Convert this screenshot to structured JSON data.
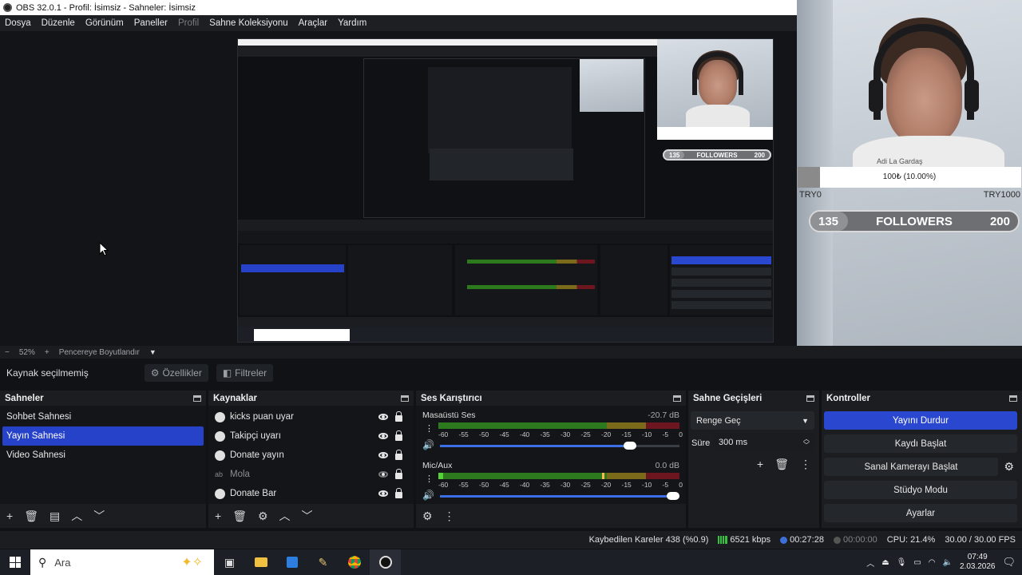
{
  "window": {
    "title": "OBS 32.0.1 - Profil: İsimsiz - Sahneler: İsimsiz"
  },
  "menu": [
    "Dosya",
    "Düzenle",
    "Görünüm",
    "Paneller",
    "Profil",
    "Sahne Koleksiyonu",
    "Araçlar",
    "Yardım"
  ],
  "overlay": {
    "donation_name": "Adi La Gardaş",
    "donation_amount": "100₺ (10.00%)",
    "goal_left": "TRY0",
    "goal_right": "TRY1000",
    "goal_progress": 0.1,
    "followers_current": "135",
    "followers_label": "FOLLOWERS",
    "followers_goal": "200",
    "followers_progress": 0.18
  },
  "preview_toolbar": {
    "zoom": "52%",
    "resize_label": "Pencereye Boyutlandır"
  },
  "source_toolbar": {
    "status": "Kaynak seçilmemiş",
    "properties": "Özellikler",
    "filters": "Filtreler"
  },
  "scenes": {
    "title": "Sahneler",
    "items": [
      "Sohbet Sahnesi",
      "Yayın Sahnesi",
      "Video Sahnesi"
    ],
    "selected_index": 1
  },
  "sources": {
    "title": "Kaynaklar",
    "items": [
      {
        "name": "kicks puan uyar",
        "visible": true
      },
      {
        "name": "Takipçi uyarı",
        "visible": true
      },
      {
        "name": "Donate yayın",
        "visible": true
      },
      {
        "name": "Mola",
        "visible": false
      },
      {
        "name": "Donate Bar",
        "visible": true
      }
    ]
  },
  "mixer": {
    "title": "Ses Karıştırıcı",
    "channels": [
      {
        "name": "Masaüstü Ses",
        "db": "-20.7 dB",
        "level": 0.0,
        "volume": 0.82
      },
      {
        "name": "Mic/Aux",
        "db": "0.0 dB",
        "level": 0.02,
        "peak": 0.68,
        "volume": 1.0
      }
    ],
    "ticks": [
      "-60",
      "-55",
      "-50",
      "-45",
      "-40",
      "-35",
      "-30",
      "-25",
      "-20",
      "-15",
      "-10",
      "-5",
      "0"
    ]
  },
  "transitions": {
    "title": "Sahne Geçişleri",
    "selected": "Renge Geç",
    "duration_label": "Süre",
    "duration_value": "300 ms"
  },
  "controls": {
    "title": "Kontroller",
    "stop_stream": "Yayını Durdur",
    "start_record": "Kaydı Başlat",
    "virtual_cam": "Sanal Kamerayı Başlat",
    "studio_mode": "Stüdyo Modu",
    "settings": "Ayarlar"
  },
  "status": {
    "dropped_frames": "Kaybedilen Kareler 438 (%0.9)",
    "bitrate": "6521 kbps",
    "stream_time": "00:27:28",
    "record_time": "00:00:00",
    "cpu": "CPU: 21.4%",
    "fps": "30.00 / 30.00 FPS"
  },
  "taskbar": {
    "search_placeholder": "Ara",
    "time": "07:49",
    "date": "2.03.2026"
  },
  "colors": {
    "accent": "#2a47cf",
    "meter_green": "#2d7a1e",
    "meter_yellow": "#7a6a1a",
    "meter_red": "#6e1620"
  }
}
